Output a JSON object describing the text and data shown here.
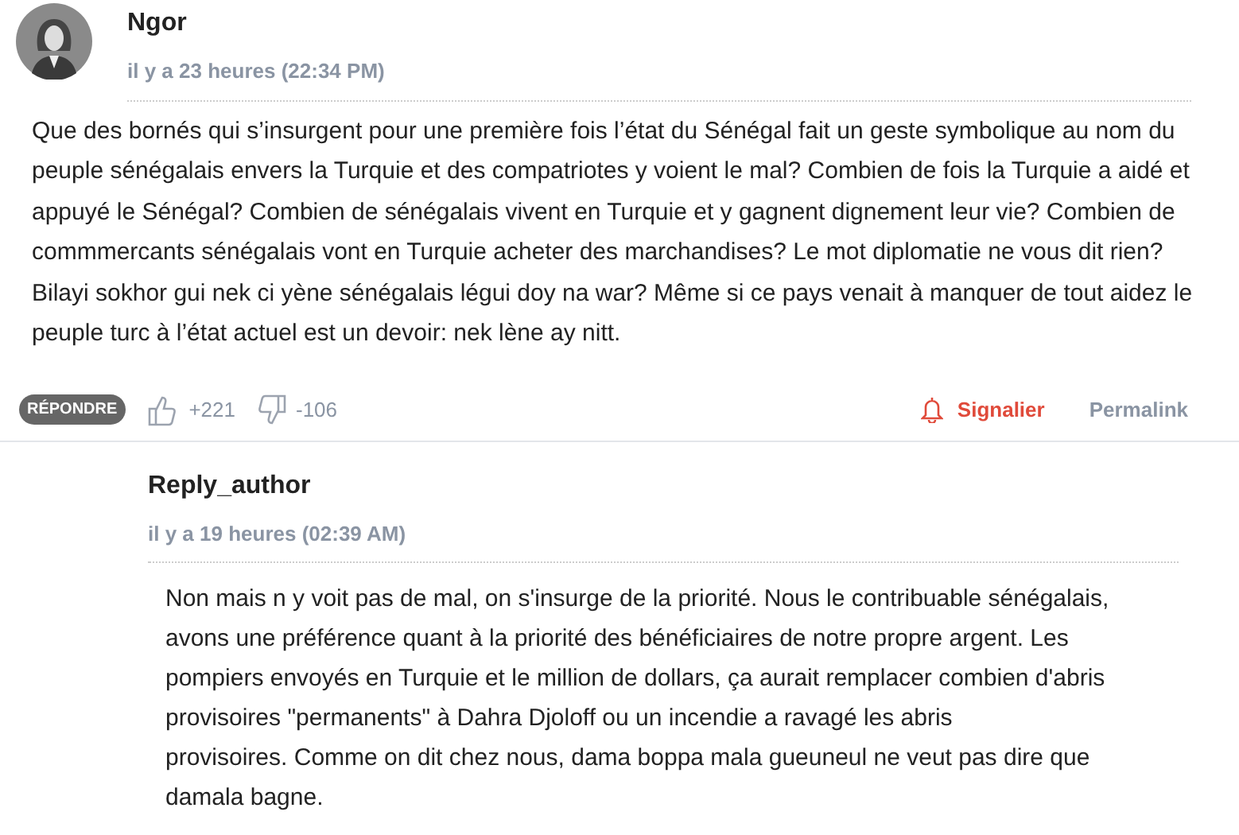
{
  "comment": {
    "author": "Ngor",
    "time": "il y a 23 heures (22:34 PM)",
    "body": "Que des bornés qui s’insurgent pour une première fois l’état du Sénégal fait un geste symbolique au nom du peuple sénégalais envers la Turquie et des compatriotes y voient le mal? Combien de fois la Turquie a aidé et appuyé le Sénégal? Combien de sénégalais vivent en Turquie et y gagnent dignement leur vie? Combien de commmercants sénégalais vont en Turquie acheter des marchandises? Le mot diplomatie ne vous dit rien? Bilayi sokhor gui nek ci yène sénégalais légui doy na war? Même si ce pays venait à manquer de tout aidez le peuple turc à l’état actuel est un devoir: nek lène ay nitt.",
    "reply_button": "RÉPONDRE",
    "upvotes": "+221",
    "downvotes": "-106",
    "report": "Signalier",
    "permalink": "Permalink"
  },
  "reply": {
    "author": "Reply_author",
    "time": "il y a 19 heures (02:39 AM)",
    "body": "Non mais n y voit pas de mal, on s'insurge de la priorité. Nous le contribuable sénégalais, avons une préférence quant à la priorité des bénéficiaires de notre propre argent.  Les pompiers envoyés en Turquie et le million de dollars, ça aurait remplacer combien d'abris provisoires \"permanents\" à Dahra Djoloff ou un incendie a ravagé les abris\nprovisoires. Comme on dit chez nous, dama boppa mala gueuneul ne veut pas dire que damala bagne."
  }
}
